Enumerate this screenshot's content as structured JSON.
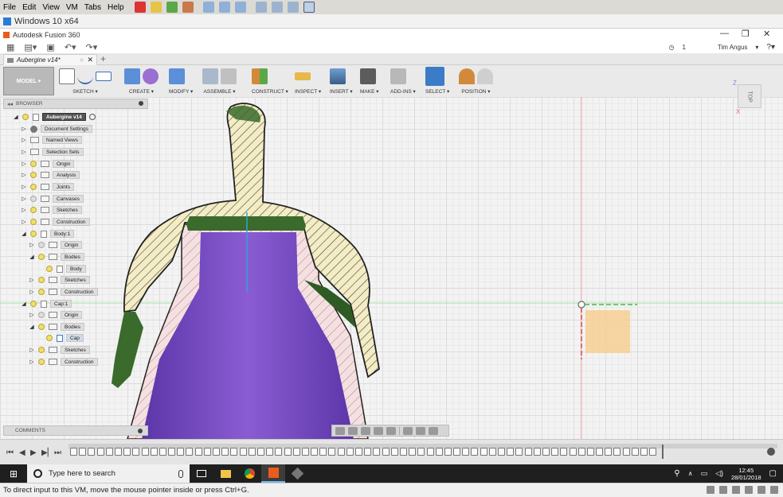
{
  "vm_menubar": {
    "items": [
      "File",
      "Edit",
      "View",
      "VM",
      "Tabs",
      "Help"
    ]
  },
  "vm_window": {
    "title": "Windows 10 x64"
  },
  "app": {
    "title": "Autodesk Fusion 360"
  },
  "quickbar": {
    "jobs_count": "1",
    "user_name": "Tim Angus"
  },
  "document_tab": {
    "name": "Aubergine v14*"
  },
  "toolbar": {
    "workspace_label": "MODEL ▾",
    "groups": [
      "SKETCH ▾",
      "CREATE ▾",
      "MODIFY ▾",
      "ASSEMBLE ▾",
      "CONSTRUCT ▾",
      "INSPECT ▾",
      "INSERT ▾",
      "MAKE ▾",
      "ADD-INS ▾",
      "SELECT ▾",
      "POSITION ▾"
    ]
  },
  "browser": {
    "title": "BROWSER",
    "items": [
      {
        "label": "Aubergine v14",
        "root": true
      },
      {
        "label": "Document Settings"
      },
      {
        "label": "Named Views"
      },
      {
        "label": "Selection Sets"
      },
      {
        "label": "Origin"
      },
      {
        "label": "Analysis"
      },
      {
        "label": "Joints"
      },
      {
        "label": "Canvases"
      },
      {
        "label": "Sketches"
      },
      {
        "label": "Construction"
      },
      {
        "label": "Body:1"
      },
      {
        "label": "Origin"
      },
      {
        "label": "Bodies"
      },
      {
        "label": "Body"
      },
      {
        "label": "Sketches"
      },
      {
        "label": "Construction"
      },
      {
        "label": "Cap:1"
      },
      {
        "label": "Origin"
      },
      {
        "label": "Bodies"
      },
      {
        "label": "Cap"
      },
      {
        "label": "Sketches"
      },
      {
        "label": "Construction"
      }
    ]
  },
  "viewcube": {
    "face": "TOP",
    "axis_z": "Z",
    "axis_x": "X"
  },
  "comments": {
    "title": "COMMENTS"
  },
  "taskbar": {
    "search_placeholder": "Type here to search",
    "time": "12:45",
    "date": "28/01/2018"
  },
  "vm_status": {
    "message": "To direct input to this VM, move the mouse pointer inside or press Ctrl+G."
  },
  "colors": {
    "cap_fill": "#f3ecc4",
    "cap_green": "#3a6a2c",
    "body_section": "#f4e0e1",
    "body_purple": "#7c4ec0",
    "accent": "#4a87c5"
  }
}
